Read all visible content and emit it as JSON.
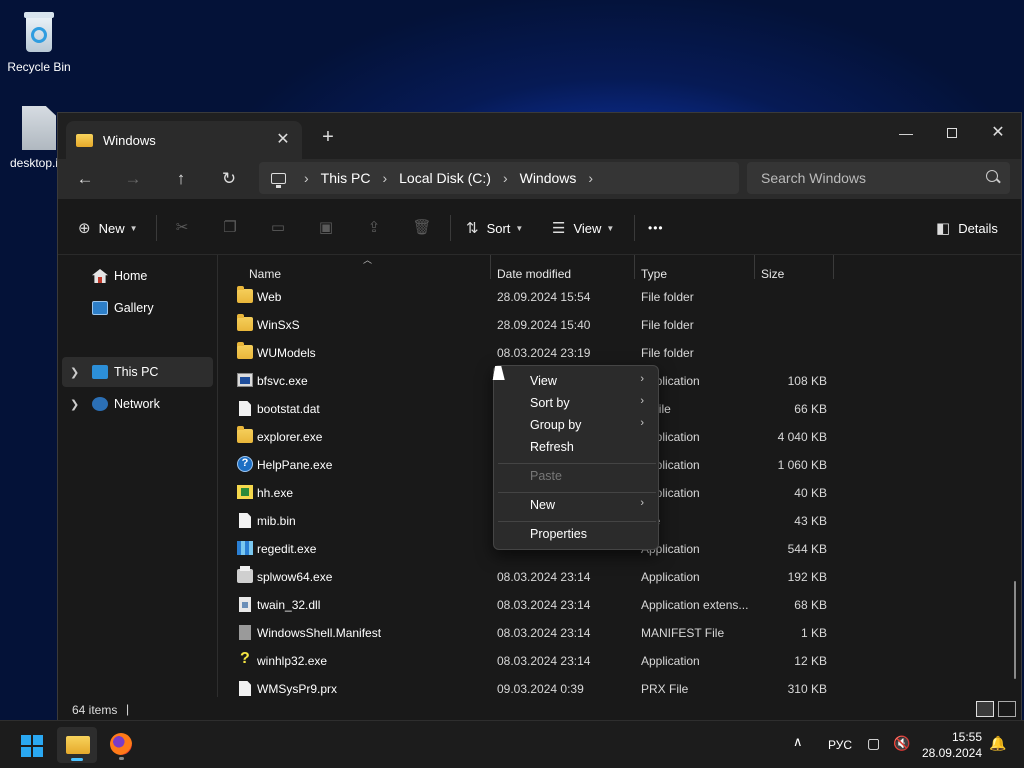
{
  "desktop": {
    "icons": [
      {
        "label": "Recycle Bin"
      },
      {
        "label": "desktop.i"
      }
    ]
  },
  "window": {
    "tab_title": "Windows",
    "tab_close": "✕",
    "new_tab": "+",
    "controls": {
      "minimize": "—",
      "close": "✕"
    },
    "nav": {
      "back": "←",
      "forward": "→",
      "up": "↑",
      "refresh": "↻"
    },
    "address": [
      "This PC",
      "Local Disk (C:)",
      "Windows"
    ],
    "crumb_sep": "›",
    "search_placeholder": "Search Windows",
    "commands": {
      "new": "New",
      "sort": "Sort",
      "view": "View",
      "more": "•••",
      "details": "Details"
    },
    "navpane": [
      {
        "label": "Home"
      },
      {
        "label": "Gallery"
      },
      {
        "label": "This PC"
      },
      {
        "label": "Network"
      }
    ],
    "columns": {
      "name": "Name",
      "date": "Date modified",
      "type": "Type",
      "size": "Size"
    },
    "files": [
      {
        "name": "Web",
        "date": "28.09.2024 15:54",
        "type": "File folder",
        "size": "",
        "icon": "folder-icon"
      },
      {
        "name": "WinSxS",
        "date": "28.09.2024 15:40",
        "type": "File folder",
        "size": "",
        "icon": "folder-icon"
      },
      {
        "name": "WUModels",
        "date": "08.03.2024 23:19",
        "type": "File folder",
        "size": "",
        "icon": "folder-icon"
      },
      {
        "name": "bfsvc.exe",
        "date": "",
        "type": "Application",
        "size": "108 KB",
        "icon": "exe-icon"
      },
      {
        "name": "bootstat.dat",
        "date": "",
        "type": "T File",
        "size": "66 KB",
        "icon": "document-icon"
      },
      {
        "name": "explorer.exe",
        "date": "",
        "type": "Application",
        "size": "4 040 KB",
        "icon": "folder-icon"
      },
      {
        "name": "HelpPane.exe",
        "date": "",
        "type": "Application",
        "size": "1 060 KB",
        "icon": "help-icon"
      },
      {
        "name": "hh.exe",
        "date": "",
        "type": "Application",
        "size": "40 KB",
        "icon": "help-book-icon"
      },
      {
        "name": "mib.bin",
        "date": "",
        "type": "File",
        "size": "43 KB",
        "icon": "document-icon"
      },
      {
        "name": "regedit.exe",
        "date": "",
        "type": "Application",
        "size": "544 KB",
        "icon": "registry-icon"
      },
      {
        "name": "splwow64.exe",
        "date": "08.03.2024 23:14",
        "type": "Application",
        "size": "192 KB",
        "icon": "printer-icon"
      },
      {
        "name": "twain_32.dll",
        "date": "08.03.2024 23:14",
        "type": "Application extens...",
        "size": "68 KB",
        "icon": "dll-icon"
      },
      {
        "name": "WindowsShell.Manifest",
        "date": "08.03.2024 23:14",
        "type": "MANIFEST File",
        "size": "1 KB",
        "icon": "manifest-icon"
      },
      {
        "name": "winhlp32.exe",
        "date": "08.03.2024 23:14",
        "type": "Application",
        "size": "12 KB",
        "icon": "question-icon"
      },
      {
        "name": "WMSysPr9.prx",
        "date": "09.03.2024 0:39",
        "type": "PRX File",
        "size": "310 KB",
        "icon": "document-icon"
      }
    ],
    "status": {
      "items": "64 items",
      "sep": "|"
    }
  },
  "context_menu": {
    "items": [
      {
        "label": "View",
        "submenu": true,
        "enabled": true
      },
      {
        "label": "Sort by",
        "submenu": true,
        "enabled": true
      },
      {
        "label": "Group by",
        "submenu": true,
        "enabled": true
      },
      {
        "label": "Refresh",
        "submenu": false,
        "enabled": true
      },
      {
        "label": "Paste",
        "submenu": false,
        "enabled": false
      },
      {
        "label": "New",
        "submenu": true,
        "enabled": true
      },
      {
        "label": "Properties",
        "submenu": false,
        "enabled": true
      }
    ],
    "arrow": "›"
  },
  "taskbar": {
    "tray_chevron": "∧",
    "language": "РУС",
    "time": "15:55",
    "date": "28.09.2024",
    "accent": "#4cc2ff"
  }
}
